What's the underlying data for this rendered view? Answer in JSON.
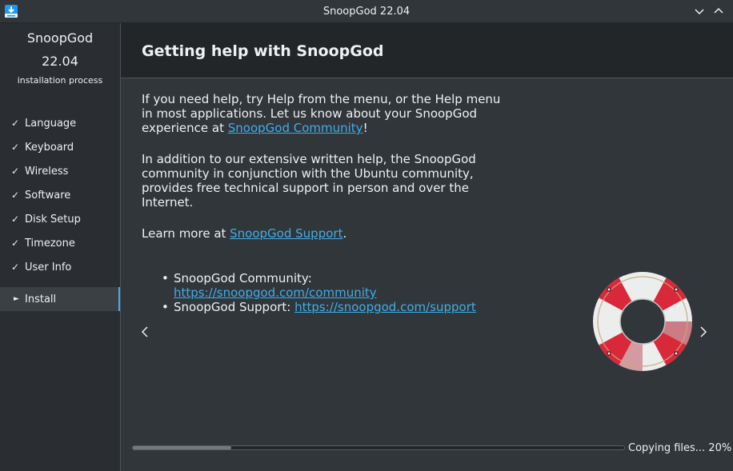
{
  "window": {
    "title": "SnoopGod 22.04",
    "app_icon": "installer-icon",
    "min_icon": "chevron-down-icon",
    "max_icon": "chevron-up-icon"
  },
  "sidebar": {
    "product": "SnoopGod",
    "version": "22.04",
    "subtitle": "installation process",
    "done_mark": "✓",
    "current_mark": "►",
    "steps": [
      {
        "label": "Language",
        "state": "done"
      },
      {
        "label": "Keyboard",
        "state": "done"
      },
      {
        "label": "Wireless",
        "state": "done"
      },
      {
        "label": "Software",
        "state": "done"
      },
      {
        "label": "Disk Setup",
        "state": "done"
      },
      {
        "label": "Timezone",
        "state": "done"
      },
      {
        "label": "User Info",
        "state": "done"
      },
      {
        "label": "Install",
        "state": "current"
      }
    ]
  },
  "slide": {
    "title": "Getting help with SnoopGod",
    "p1_before": "If you need help, try Help from the menu, or the Help menu in most applications. Let us know about your SnoopGod experience at ",
    "p1_link": "SnoopGod Community",
    "p1_after": "!",
    "p2": "In addition to our extensive written help, the SnoopGod community in conjunction with the Ubuntu community, provides free technical support in person and over the Internet.",
    "p3_before": "Learn more at ",
    "p3_link": "SnoopGod Support",
    "p3_after": ".",
    "bullet_char": "•",
    "bullets": [
      {
        "label": "SnoopGod Community: ",
        "url": "https://snoopgod.com/community"
      },
      {
        "label": "SnoopGod Support: ",
        "url": "https://snoopgod.com/support"
      }
    ],
    "prev_icon": "chevron-left-icon",
    "next_icon": "chevron-right-icon",
    "image": "lifebuoy-icon"
  },
  "progress": {
    "value": 0.2,
    "label": "Copying files... 20%"
  },
  "colors": {
    "accent": "#3daee9",
    "background": "#31363b",
    "header": "#232629",
    "buoy_red": "#d8283a"
  }
}
